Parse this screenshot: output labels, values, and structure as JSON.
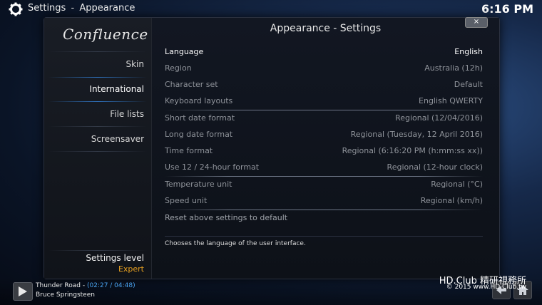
{
  "header": {
    "section": "Settings",
    "separator": "-",
    "page": "Appearance",
    "clock": "6:16 PM"
  },
  "sidebar": {
    "logo": "Confluence",
    "items": [
      {
        "label": "Skin"
      },
      {
        "label": "International"
      },
      {
        "label": "File lists"
      },
      {
        "label": "Screensaver"
      }
    ],
    "settings_level_label": "Settings level",
    "settings_level_value": "Expert"
  },
  "dialog": {
    "title": "Appearance - Settings",
    "close_glyph": "×"
  },
  "settings": [
    {
      "label": "Language",
      "value": "English"
    },
    {
      "label": "Region",
      "value": "Australia (12h)"
    },
    {
      "label": "Character set",
      "value": "Default"
    },
    {
      "label": "Keyboard layouts",
      "value": "English QWERTY"
    },
    {
      "label": "Short date format",
      "value": "Regional (12/04/2016)"
    },
    {
      "label": "Long date format",
      "value": "Regional (Tuesday, 12 April 2016)"
    },
    {
      "label": "Time format",
      "value": "Regional (6:16:20 PM (h:mm:ss xx))"
    },
    {
      "label": "Use 12 / 24-hour format",
      "value": "Regional (12-hour clock)"
    },
    {
      "label": "Temperature unit",
      "value": "Regional (°C)"
    },
    {
      "label": "Speed unit",
      "value": "Regional (km/h)"
    },
    {
      "label": "Reset above settings to default",
      "value": ""
    }
  ],
  "description": "Chooses the language of the user interface.",
  "now_playing": {
    "title": "Thunder Road - ",
    "time": "(02:27 / 04:48)",
    "artist": "Bruce Springsteen"
  },
  "watermark": {
    "line1": "HD.Club 精研視務所",
    "line2": "© 2015  www.HD.Club.tw"
  },
  "colors": {
    "accent": "#4aa3f0",
    "level": "#e6a020"
  }
}
